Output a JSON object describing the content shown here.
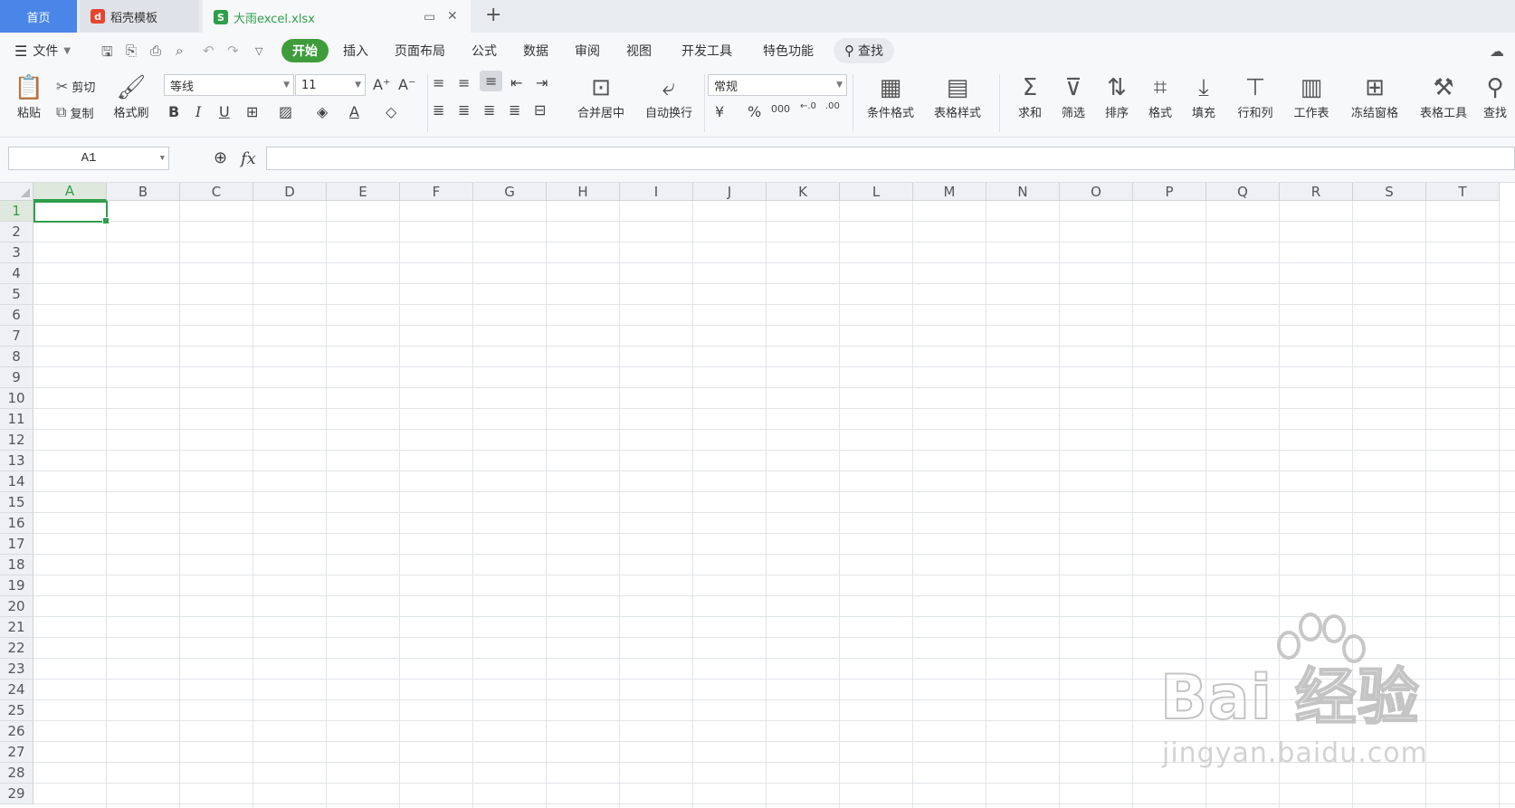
{
  "tabs": {
    "home": "首页",
    "docer": "稻壳模板",
    "file": "大雨excel.xlsx",
    "new_tab_icon": "plus-icon"
  },
  "menu": {
    "file": "文件",
    "items": [
      "开始",
      "插入",
      "页面布局",
      "公式",
      "数据",
      "审阅",
      "视图",
      "开发工具",
      "特色功能"
    ],
    "search": "查找"
  },
  "ribbon": {
    "paste": "粘贴",
    "cut": "剪切",
    "copy": "复制",
    "format_painter": "格式刷",
    "font_name": "等线",
    "font_size": "11",
    "merge_center": "合并居中",
    "wrap_text": "自动换行",
    "number_format": "常规",
    "conditional_format": "条件格式",
    "table_style": "表格样式",
    "sum": "求和",
    "filter": "筛选",
    "sort": "排序",
    "format": "格式",
    "fill": "填充",
    "row_col": "行和列",
    "worksheet": "工作表",
    "freeze_panes": "冻结窗格",
    "table_tools": "表格工具",
    "find": "查找"
  },
  "formula_bar": {
    "name_box": "A1",
    "fx": "fx",
    "formula": ""
  },
  "sheet": {
    "columns": [
      "A",
      "B",
      "C",
      "D",
      "E",
      "F",
      "G",
      "H",
      "I",
      "J",
      "K",
      "L",
      "M",
      "N",
      "O",
      "P",
      "Q",
      "R",
      "S",
      "T"
    ],
    "rows": [
      "1",
      "2",
      "3",
      "4",
      "5",
      "6",
      "7",
      "8",
      "9",
      "10",
      "11",
      "12",
      "13",
      "14",
      "15",
      "16",
      "17",
      "18",
      "19",
      "20",
      "21",
      "22",
      "23",
      "24",
      "25",
      "26",
      "27",
      "28",
      "29"
    ],
    "active_cell": "A1"
  },
  "watermark": {
    "brand": "Bai  经验",
    "url": "jingyan.baidu.com"
  },
  "colors": {
    "accent_green": "#2e9e4a",
    "home_tab_blue": "#4a86e8"
  }
}
